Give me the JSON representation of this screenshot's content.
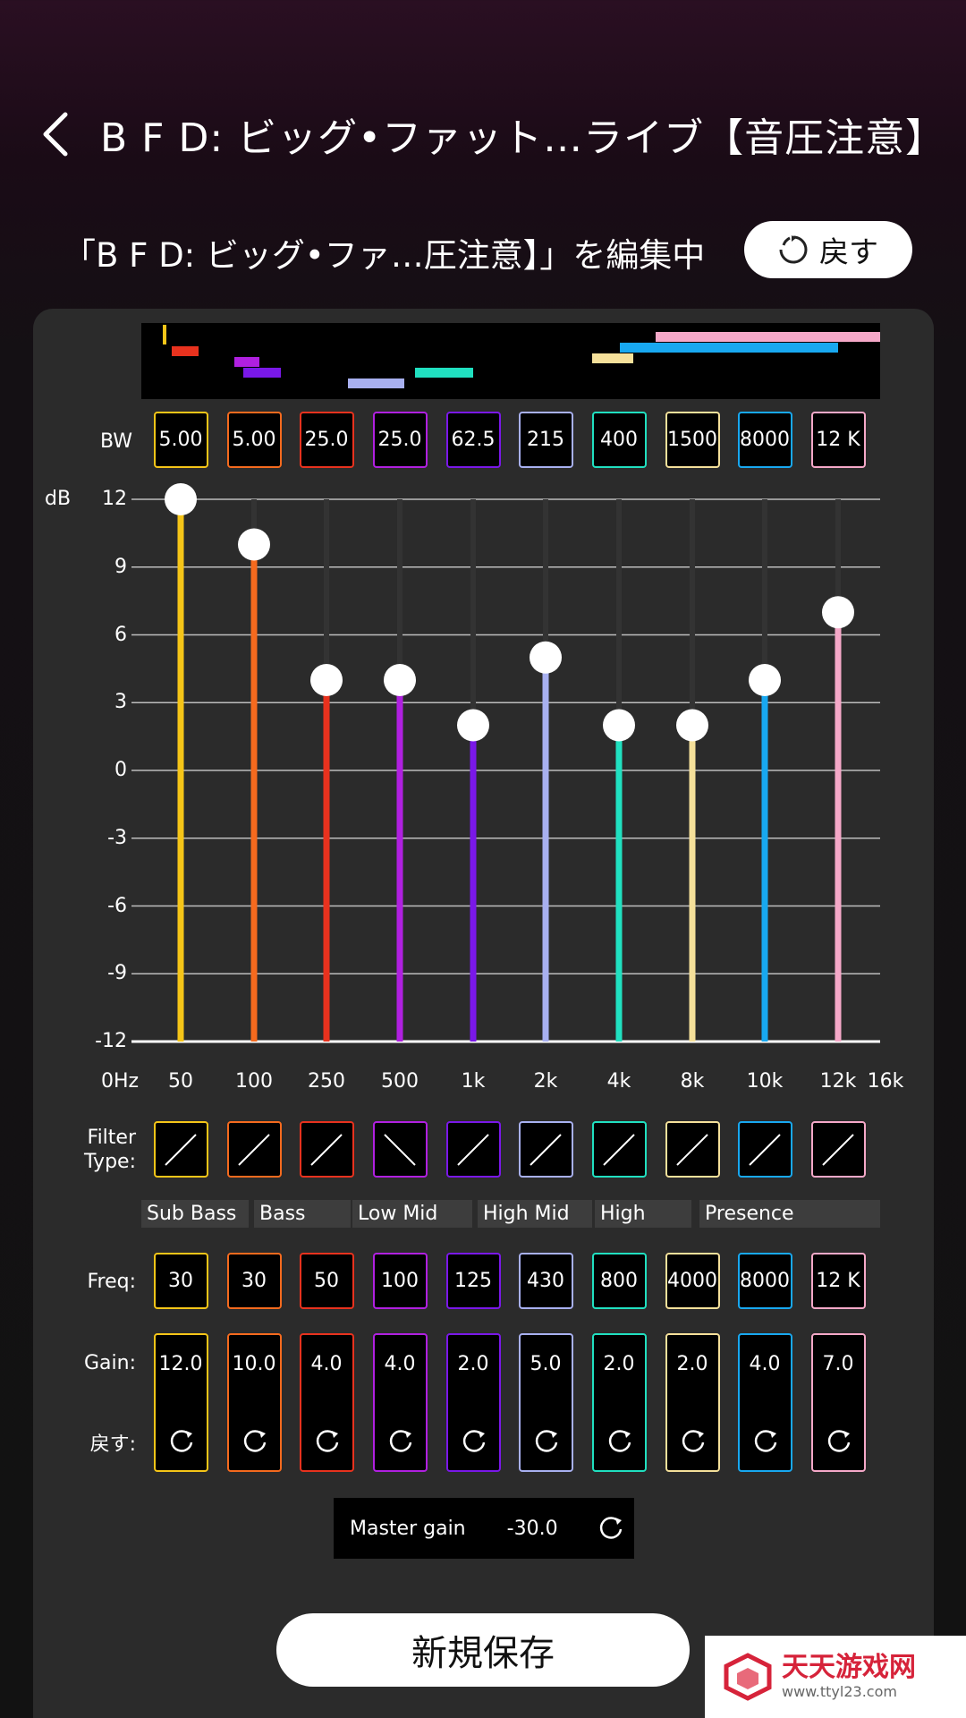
{
  "header": {
    "title": "B F D: ビッグ•ファット…ライブ【音圧注意】"
  },
  "subheader": {
    "editing_label": "「B F D: ビッグ•ファ…圧注意】」を編集中",
    "revert_label": "戻す"
  },
  "labels": {
    "bw": "BW",
    "filter_type": "Filter\nType:",
    "freq": "Freq:",
    "gain": "Gain:",
    "reset": "戻す:"
  },
  "band_colors": [
    "#f5c518",
    "#f56a1e",
    "#e8321e",
    "#b020e0",
    "#7a18e8",
    "#a8b0f0",
    "#20e0c0",
    "#f5e09a",
    "#18a8f0",
    "#f5a8c8"
  ],
  "bands": [
    {
      "bw": "5.00",
      "freq": "30",
      "gain": "12.0",
      "filter": "peak"
    },
    {
      "bw": "5.00",
      "freq": "30",
      "gain": "10.0",
      "filter": "peak"
    },
    {
      "bw": "25.0",
      "freq": "50",
      "gain": "4.0",
      "filter": "peak"
    },
    {
      "bw": "25.0",
      "freq": "100",
      "gain": "4.0",
      "filter": "low-cut"
    },
    {
      "bw": "62.5",
      "freq": "125",
      "gain": "2.0",
      "filter": "peak"
    },
    {
      "bw": "215",
      "freq": "430",
      "gain": "5.0",
      "filter": "peak"
    },
    {
      "bw": "400",
      "freq": "800",
      "gain": "2.0",
      "filter": "peak"
    },
    {
      "bw": "1500",
      "freq": "4000",
      "gain": "2.0",
      "filter": "peak"
    },
    {
      "bw": "8000",
      "freq": "8000",
      "gain": "4.0",
      "filter": "peak"
    },
    {
      "bw": "12 K",
      "freq": "12 K",
      "gain": "7.0",
      "filter": "peak"
    }
  ],
  "chart_data": {
    "type": "bar",
    "ylabel": "dB",
    "ylim": [
      -12,
      12
    ],
    "y_ticks": [
      "12",
      "9",
      "6",
      "3",
      "0",
      "-3",
      "-6",
      "-9",
      "-12"
    ],
    "x_ticks": [
      "0Hz",
      "50",
      "100",
      "250",
      "500",
      "1k",
      "2k",
      "4k",
      "8k",
      "10k",
      "12k",
      "16k"
    ],
    "categories": [
      "50",
      "100",
      "250",
      "500",
      "1k",
      "2k",
      "4k",
      "8k",
      "10k",
      "12k"
    ],
    "values": [
      12,
      10,
      4,
      4,
      2,
      5,
      2,
      2,
      4,
      7
    ],
    "grid": true
  },
  "band_labels": [
    "Sub Bass",
    "Bass",
    "Low Mid",
    "High Mid",
    "High",
    "Presence"
  ],
  "master": {
    "label": "Master gain",
    "value": "-30.0"
  },
  "save_label": "新規保存",
  "watermark": {
    "title": "天天游戏网",
    "url": "www.ttyl23.com"
  }
}
